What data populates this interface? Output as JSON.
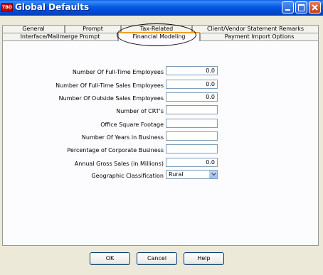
{
  "window": {
    "title": "Global Defaults",
    "app_icon_text": "TBO"
  },
  "tabs": {
    "row1": [
      {
        "label": "General"
      },
      {
        "label": "Prompt"
      },
      {
        "label": "Tax-Related"
      },
      {
        "label": "Client/Vendor Statement Remarks"
      }
    ],
    "row2": [
      {
        "label": "Interface/Mailmerge Prompt"
      },
      {
        "label": "Financial Modeling",
        "active": true
      },
      {
        "label": "Payment Import Options"
      }
    ]
  },
  "form": {
    "fields": [
      {
        "label": "Number Of Full-Time Employees",
        "value": "0.0"
      },
      {
        "label": "Number Of Full-Time Sales Employees",
        "value": "0.0"
      },
      {
        "label": "Number Of Outside Sales Employees",
        "value": "0.0"
      },
      {
        "label": "Number of CRT's",
        "value": ""
      },
      {
        "label": "Office Square Footage",
        "value": ""
      },
      {
        "label": "Number Of Years in Business",
        "value": ""
      },
      {
        "label": "Percentage of Corporate Business",
        "value": ""
      },
      {
        "label": "Annual Gross Sales (in Millions)",
        "value": "0.0"
      }
    ],
    "geographic": {
      "label": "Geographic Classification",
      "selected": "Rural"
    }
  },
  "buttons": {
    "ok": "OK",
    "cancel": "Cancel",
    "help": "Help"
  },
  "colors": {
    "titlebar": "#0058e6",
    "active_tab_accent": "#f0a028",
    "window_bg": "#ece9d8"
  },
  "icons": {
    "window_controls": [
      "minimize-icon",
      "maximize-icon",
      "close-icon"
    ],
    "dropdown": "chevron-down-icon"
  }
}
